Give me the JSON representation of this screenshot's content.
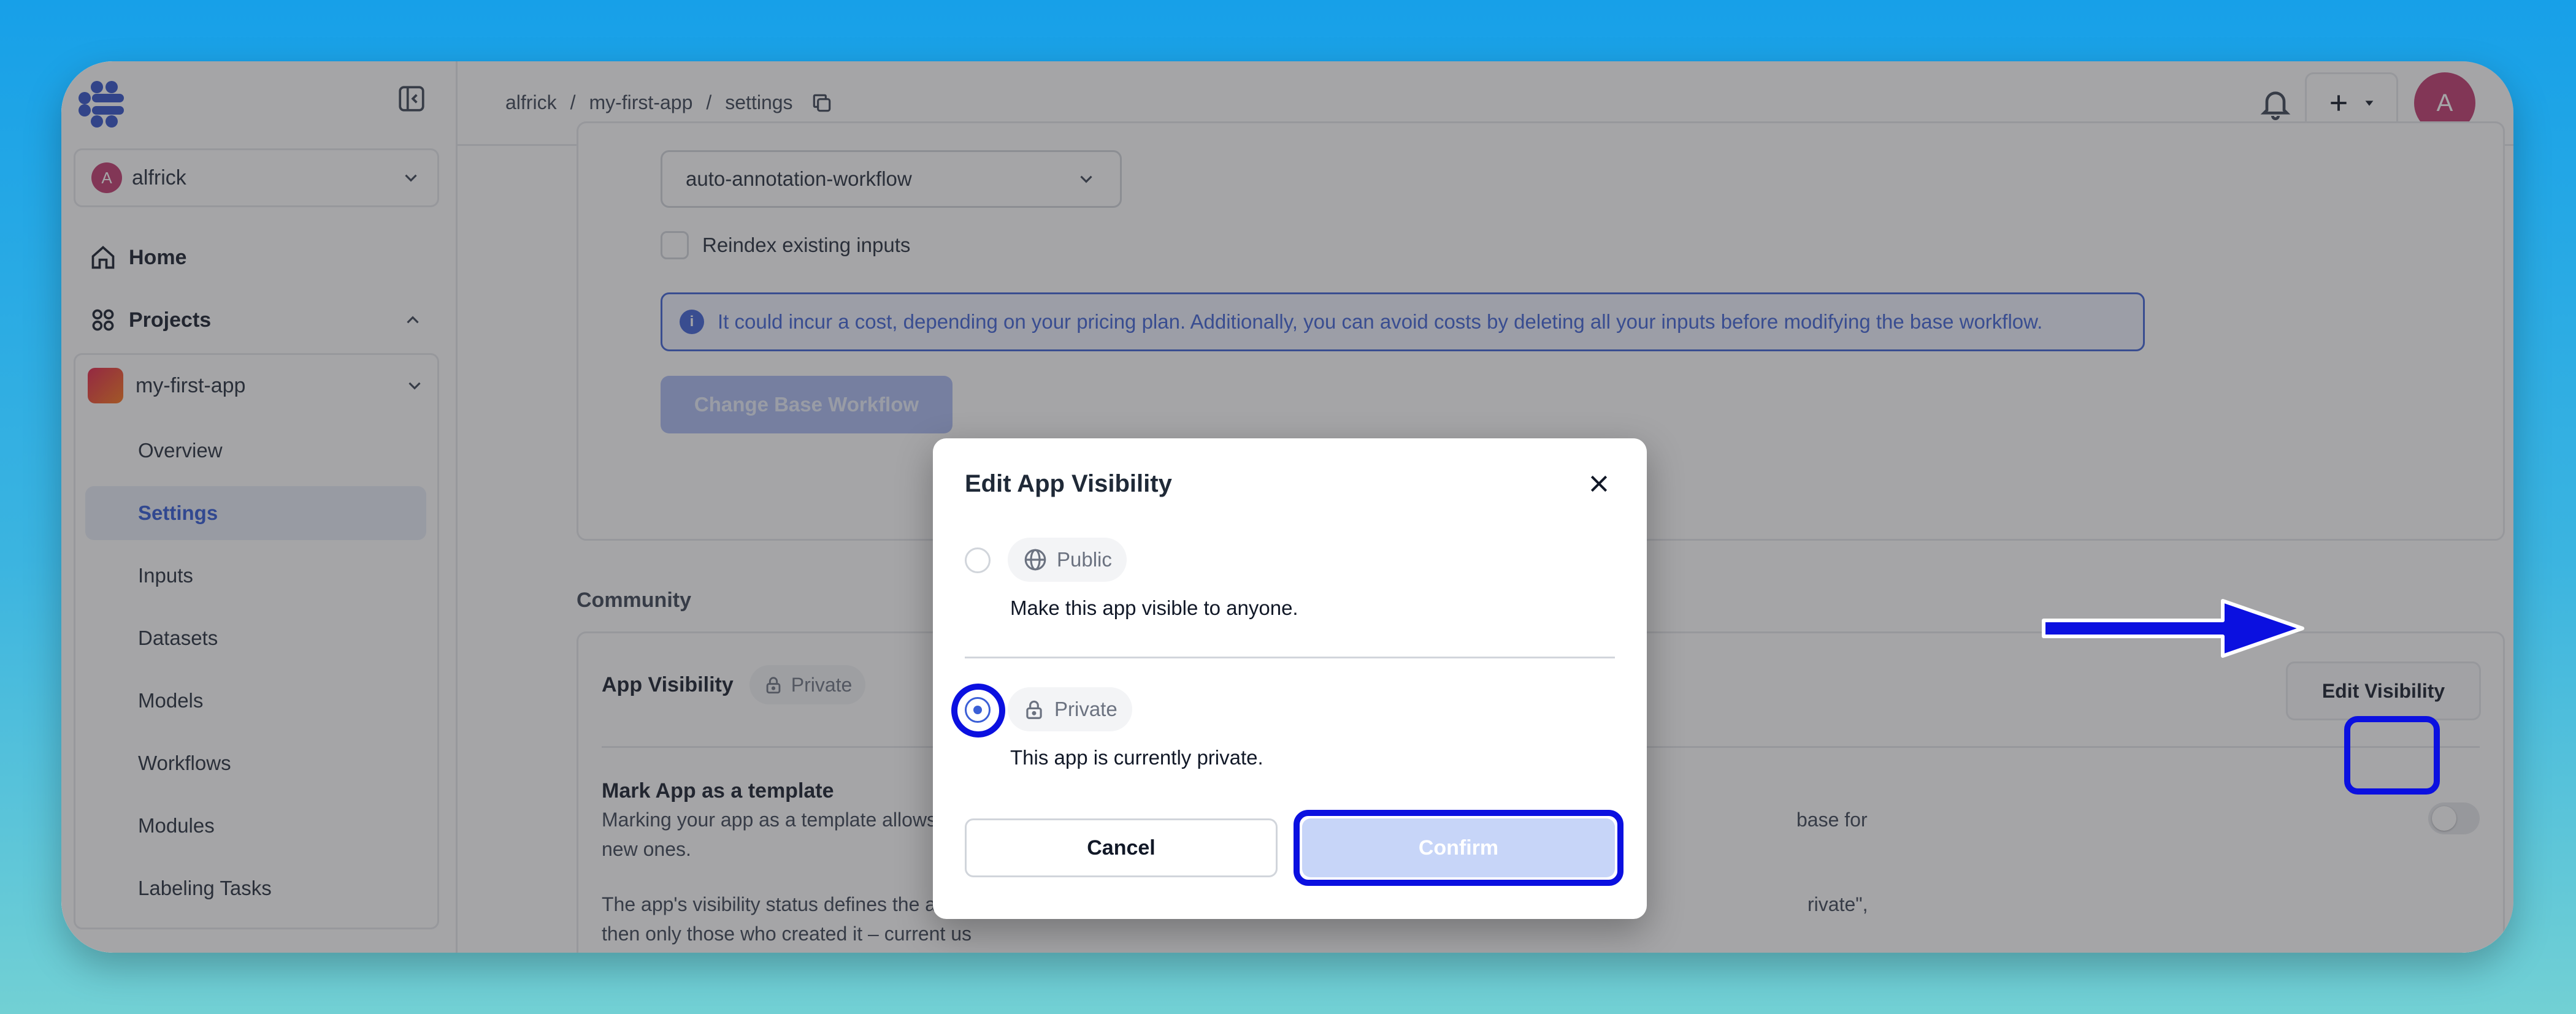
{
  "sidebar": {
    "user_name": "alfrick",
    "user_initial": "A",
    "nav": {
      "home": "Home",
      "projects": "Projects"
    },
    "project": {
      "name": "my-first-app",
      "items": [
        "Overview",
        "Settings",
        "Inputs",
        "Datasets",
        "Models",
        "Workflows",
        "Modules",
        "Labeling Tasks"
      ],
      "active": "Settings"
    }
  },
  "topbar": {
    "breadcrumb": [
      "alfrick",
      "my-first-app",
      "settings"
    ],
    "avatar_initial": "A"
  },
  "workflow": {
    "selected": "auto-annotation-workflow",
    "reindex_label": "Reindex existing inputs",
    "info_text": "It could incur a cost, depending on your pricing plan. Additionally, you can avoid costs by deleting all your inputs before modifying the base workflow.",
    "change_button": "Change Base Workflow"
  },
  "community": {
    "title": "Community",
    "visibility_label": "App Visibility",
    "visibility_value": "Private",
    "edit_button": "Edit Visibility",
    "template_title": "Mark App as a template",
    "template_desc_1": "Marking your app as a template allows usin",
    "template_desc_1b": "base for",
    "template_desc_2": "new ones.",
    "status_desc_1": "The app's visibility status defines the acces",
    "status_desc_1b": "rivate\",",
    "status_desc_2": "then only those who created it – current us",
    "template_toggle_on": false
  },
  "modal": {
    "title": "Edit App Visibility",
    "options": [
      {
        "label": "Public",
        "desc": "Make this app visible to anyone.",
        "icon": "globe-icon",
        "selected": false
      },
      {
        "label": "Private",
        "desc": "This app is currently private.",
        "icon": "lock-icon",
        "selected": true
      }
    ],
    "cancel": "Cancel",
    "confirm": "Confirm"
  },
  "colors": {
    "accent": "#3b5fd6",
    "annotation": "#0b10e0",
    "avatar": "#c0356c"
  }
}
